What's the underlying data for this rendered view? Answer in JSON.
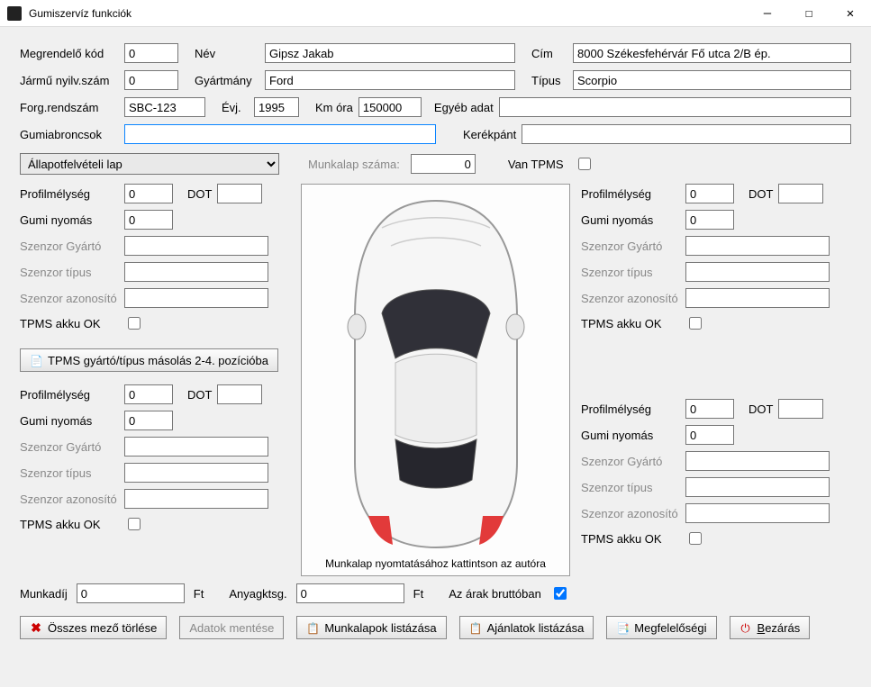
{
  "window": {
    "title": "Gumiszervíz funkciók",
    "minimize": "—",
    "maximize": "☐",
    "close": "✕"
  },
  "top": {
    "order_code_label": "Megrendelő kód",
    "order_code": "0",
    "name_label": "Név",
    "name": "Gipsz Jakab",
    "address_label": "Cím",
    "address": "8000 Székesfehérvár Fő utca 2/B ép.",
    "vehicle_reg_no_label": "Jármű nyilv.szám",
    "vehicle_reg_no": "0",
    "make_label": "Gyártmány",
    "make": "Ford",
    "type_label": "Típus",
    "type": "Scorpio",
    "plate_label": "Forg.rendszám",
    "plate": "SBC-123",
    "year_label": "Évj.",
    "year": "1995",
    "km_label": "Km óra",
    "km": "150000",
    "other_label": "Egyéb adat",
    "other": "",
    "tires_label": "Gumiabroncsok",
    "tires": "",
    "rim_label": "Kerékpánt",
    "rim": ""
  },
  "mid": {
    "sheet_select": "Állapotfelvételi lap",
    "worksheet_no_label": "Munkalap száma:",
    "worksheet_no": "0",
    "has_tpms_label": "Van TPMS",
    "has_tpms": false
  },
  "tire_labels": {
    "tread": "Profilmélység",
    "dot": "DOT",
    "pressure": "Gumi nyomás",
    "sensor_maker": "Szenzor Gyártó",
    "sensor_type": "Szenzor típus",
    "sensor_id": "Szenzor azonosító",
    "tpms_batt": "TPMS akku OK"
  },
  "tires": {
    "fl": {
      "tread": "0",
      "dot": "",
      "pressure": "0",
      "smaker": "",
      "stype": "",
      "sid": "",
      "batt": false
    },
    "fr": {
      "tread": "0",
      "dot": "",
      "pressure": "0",
      "smaker": "",
      "stype": "",
      "sid": "",
      "batt": false
    },
    "rl": {
      "tread": "0",
      "dot": "",
      "pressure": "0",
      "smaker": "",
      "stype": "",
      "sid": "",
      "batt": false
    },
    "rr": {
      "tread": "0",
      "dot": "",
      "pressure": "0",
      "smaker": "",
      "stype": "",
      "sid": "",
      "batt": false
    }
  },
  "copy_btn": "TPMS gyártó/típus másolás 2-4. pozícióba",
  "car_hint": "Munkalap nyomtatásához kattintson az autóra",
  "costs": {
    "labor_label": "Munkadíj",
    "labor": "0",
    "currency": "Ft",
    "material_label": "Anyagktsg.",
    "material": "0",
    "gross_label": "Az árak bruttóban",
    "gross": true
  },
  "buttons": {
    "clear_all": "Összes mező törlése",
    "save": "Adatok mentése",
    "list_worksheets": "Munkalapok listázása",
    "list_offers": "Ajánlatok listázása",
    "compliance": "Megfelelőségi",
    "close": "Bezárás"
  }
}
